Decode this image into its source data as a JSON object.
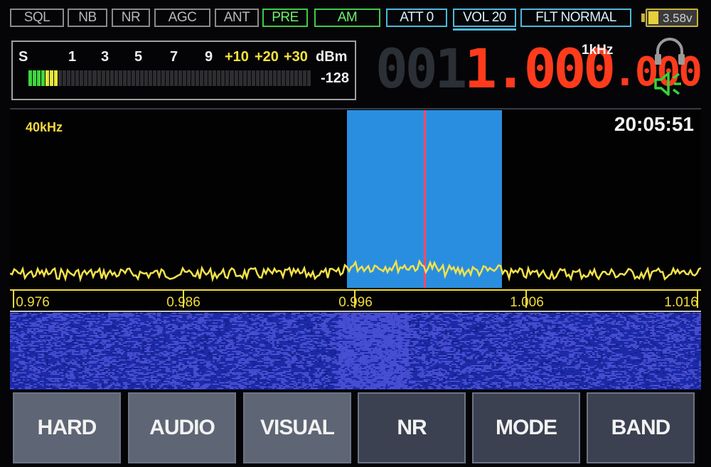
{
  "top_bar": {
    "buttons": [
      {
        "label": "SQL",
        "style": "gray"
      },
      {
        "label": "NB",
        "style": "gray"
      },
      {
        "label": "NR",
        "style": "gray"
      },
      {
        "label": "AGC",
        "style": "gray"
      },
      {
        "label": "ANT",
        "style": "gray"
      },
      {
        "label": "PRE",
        "style": "green"
      },
      {
        "label": "AM",
        "style": "green"
      },
      {
        "label": "ATT 0",
        "style": "cyan"
      },
      {
        "label": "VOL 20",
        "style": "cyan-selected"
      },
      {
        "label": "FLT NORMAL",
        "style": "cyan"
      }
    ],
    "battery": {
      "voltage": "3.58v",
      "level": 0.2,
      "icon": "battery-icon"
    }
  },
  "smeter": {
    "scale": [
      "S",
      "1",
      "3",
      "5",
      "7",
      "9",
      "+10",
      "+20",
      "+30"
    ],
    "unit": "dBm",
    "value": "-128",
    "lit_green_segments": 4,
    "lit_yellow_segments": 3,
    "total_segments": 66
  },
  "frequency": {
    "dim_digits": "001",
    "main": "1.000",
    "fraction": ".000",
    "step": "1kHz"
  },
  "icons": {
    "headphones": "headphones-icon",
    "speaker": "speaker-icon"
  },
  "spectrum": {
    "span": "40kHz",
    "time": "20:05:51",
    "axis_labels": [
      "0.976",
      "0.986",
      "0.996",
      "1.006",
      "1.016"
    ],
    "colors": {
      "passband": "#2a8ee0",
      "trace": "#f2e24a",
      "carrier": "#ff4a6a"
    }
  },
  "menu": {
    "buttons": [
      "HARD",
      "AUDIO",
      "VISUAL",
      "NR",
      "MODE",
      "BAND"
    ]
  }
}
